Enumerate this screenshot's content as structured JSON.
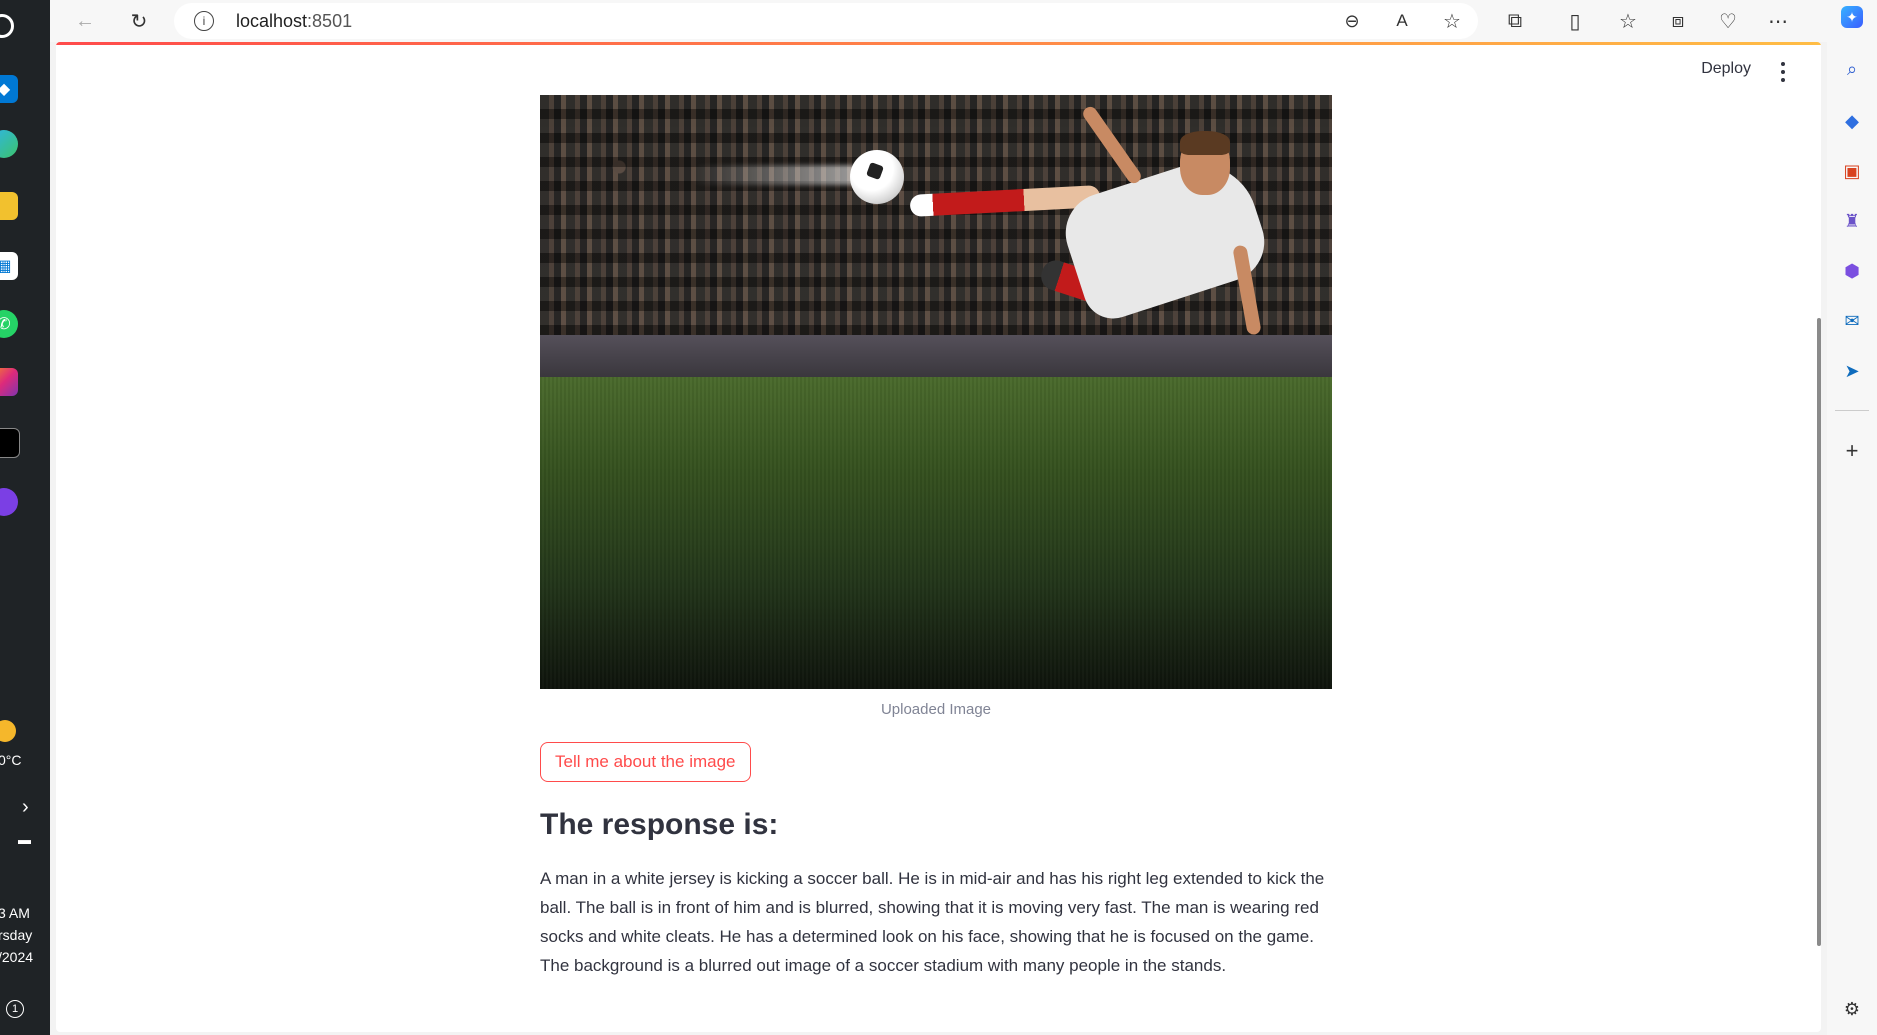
{
  "taskbar": {
    "weather_temp": "0°C",
    "time": "3 AM",
    "day": "rsday",
    "date": "/2024",
    "notification_count": "1"
  },
  "browser": {
    "url_host": "localhost",
    "url_port": ":8501",
    "accent_color": "#ff4b4b"
  },
  "app": {
    "deploy_label": "Deploy",
    "image_caption": "Uploaded Image",
    "action_button_label": "Tell me about the image",
    "response_heading": "The response is:",
    "response_text": "A man in a white jersey is kicking a soccer ball. He is in mid-air and has his right leg extended to kick the ball. The ball is in front of him and is blurred, showing that it is moving very fast. The man is wearing red socks and white cleats. He has a determined look on his face, showing that he is focused on the game. The background is a blurred out image of a soccer stadium with many people in the stands."
  },
  "icons": {
    "back": "back-arrow-icon",
    "refresh": "refresh-icon",
    "info": "info-icon",
    "zoom_out": "zoom-out-icon",
    "read_aloud": "read-aloud-icon",
    "favorite": "star-icon",
    "extensions": "puzzle-icon",
    "split_screen": "split-screen-icon",
    "favorites": "favorites-icon",
    "collections": "collections-icon",
    "health": "heart-pulse-icon",
    "more": "more-icon",
    "copilot": "copilot-icon"
  }
}
